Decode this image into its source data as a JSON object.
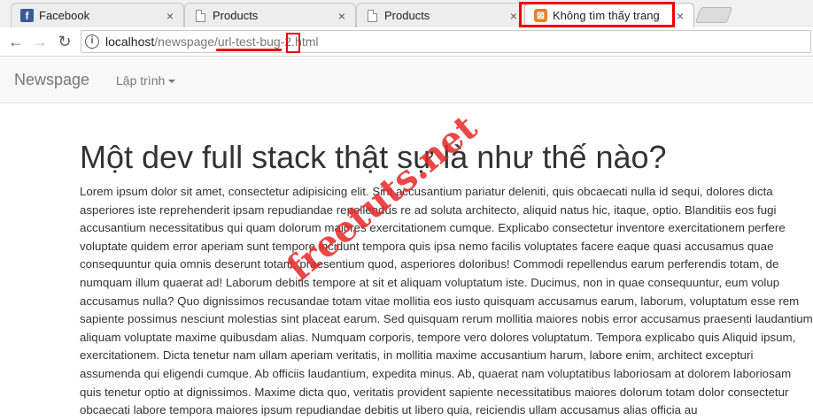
{
  "tabs": [
    {
      "title": "Facebook",
      "icon": "facebook-icon",
      "close": "×"
    },
    {
      "title": "Products",
      "icon": "page-icon",
      "close": "×"
    },
    {
      "title": "Products",
      "icon": "page-icon",
      "close": "×"
    },
    {
      "title": "Không tìm thấy trang",
      "icon": "xampp-icon",
      "close": "×"
    }
  ],
  "toolbar": {
    "back": "←",
    "forward": "→",
    "reload": "↻",
    "info": "i",
    "url_host": "localhost",
    "url_path1": "/newspage/",
    "url_path2": "url-test-bug",
    "url_path3": "-",
    "url_num": "2",
    "url_ext": ".html"
  },
  "site": {
    "brand": "Newspage",
    "menu_label": "Lập trình"
  },
  "article": {
    "title": "Một dev full stack thật sự là như thế nào?",
    "body": "Lorem ipsum dolor sit amet, consectetur adipisicing elit. Sint accusantium pariatur deleniti, quis obcaecati nulla id sequi, dolores dicta asperiores iste reprehenderit ipsam repudiandae repellendus re ad soluta architecto, aliquid natus hic, itaque, optio. Blanditiis eos fugi accusantium necessitatibus qui quam dolorum maiores exercitationem cumque. Explicabo consectetur inventore exercitationem perfere voluptate quidem error aperiam sunt tempore incidunt tempora quis ipsa nemo facilis voluptates facere eaque quasi accusamus quae consequuntur quia omnis deserunt totam, praesentium quod, asperiores doloribus! Commodi repellendus earum perferendis totam, de numquam illum quaerat ad! Laborum debitis tempore at sit et aliquam voluptatum iste. Ducimus, non in quae consequuntur, eum volup accusamus nulla? Quo dignissimos recusandae totam vitae mollitia eos iusto quisquam accusamus earum, laborum, voluptatum esse rem sapiente possimus nesciunt molestias sint placeat earum. Sed quisquam rerum mollitia maiores nobis error accusamus praesenti laudantium aliquam voluptate maxime quibusdam alias. Numquam corporis, tempore vero dolores voluptatum. Tempora explicabo quis Aliquid ipsum, exercitationem. Dicta tenetur nam ullam aperiam veritatis, in mollitia maxime accusantium harum, labore enim, architect excepturi assumenda qui eligendi cumque. Ab officiis laudantium, expedita minus. Ab, quaerat nam voluptatibus laboriosam at dolorem laboriosam quis tenetur optio at dignissimos. Maxime dicta quo, veritatis provident sapiente necessitatibus maiores dolorum totam dolor consectetur obcaecati labore tempora maiores ipsum repudiandae debitis ut libero quia, reiciendis ullam accusamus alias officia au"
  },
  "watermark": "freetuts.net",
  "colors": {
    "highlight_red": "#e00000",
    "facebook_blue": "#3b5998",
    "xampp_orange": "#f47c20"
  }
}
